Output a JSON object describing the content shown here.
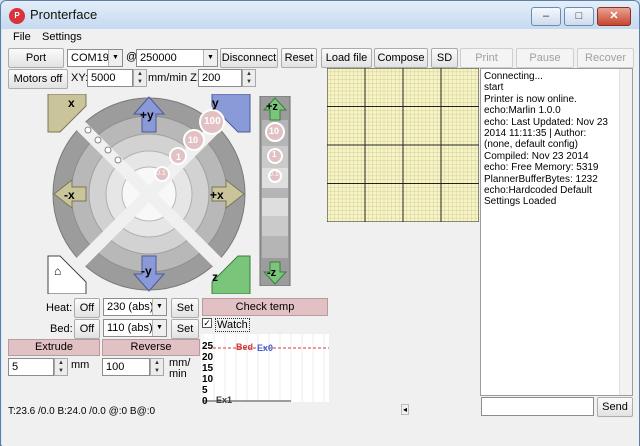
{
  "app": {
    "title": "Pronterface",
    "icon_text": "P"
  },
  "window_controls": {
    "minimize": "–",
    "maximize": "□",
    "close": "✕"
  },
  "menu": [
    "File",
    "Settings"
  ],
  "toolbar": {
    "port_label": "Port",
    "port_value": "COM19",
    "at": "@",
    "baud_value": "250000",
    "disconnect": "Disconnect",
    "reset": "Reset",
    "load_file": "Load file",
    "compose": "Compose",
    "sd": "SD",
    "print": "Print",
    "pause": "Pause",
    "recover": "Recover"
  },
  "motion": {
    "motors_off": "Motors off",
    "xy_label": "XY:",
    "xy_value": "5000",
    "mm_min_z": "mm/min Z:",
    "z_value": "200"
  },
  "jog": {
    "home_x": "x",
    "home_y": "y",
    "home_z": "z",
    "plus_y": "+y",
    "minus_y": "-y",
    "plus_x": "+x",
    "minus_x": "-x",
    "steps": [
      "100",
      "10",
      "1",
      "0.1"
    ],
    "z_plus": "+z",
    "z_minus": "-z",
    "z_steps": [
      "10",
      "1",
      "0.1"
    ]
  },
  "temps": {
    "heat_label": "Heat:",
    "heat_off": "Off",
    "heat_value": "230 (abs)",
    "heat_set": "Set",
    "bed_label": "Bed:",
    "bed_off": "Off",
    "bed_value": "110 (abs)",
    "bed_set": "Set",
    "check_temp": "Check temp",
    "watch": "Watch"
  },
  "extrude": {
    "extrude": "Extrude",
    "reverse": "Reverse",
    "length": "5",
    "length_unit": "mm",
    "speed": "100",
    "speed_unit": "mm/\nmin"
  },
  "graph": {
    "ticks": [
      "25",
      "20",
      "15",
      "10",
      "5",
      "0"
    ],
    "bed_label": "Bed",
    "ex0_label": "Ex0",
    "ex1_label": "Ex1",
    "bed_color": "#d23a3a",
    "ex0_color": "#3a5fd2",
    "ex1_color": "#3a3a3a"
  },
  "log": {
    "lines": [
      "Connecting...",
      "start",
      "Printer is now online.",
      "echo:Marlin 1.0.0",
      "echo: Last Updated: Nov 23",
      "2014 11:11:35 | Author:",
      "(none, default config)",
      "Compiled: Nov 23 2014",
      "echo: Free Memory: 5319",
      "PlannerBufferBytes: 1232",
      "echo:Hardcoded Default",
      "Settings Loaded"
    ]
  },
  "send": {
    "button": "Send",
    "value": ""
  },
  "status": {
    "text": "T:23.6 /0.0 B:24.0 /0.0 @:0 B@:0"
  },
  "colors": {
    "grid_bg": "#f7f5c6",
    "arrow_blue": "#8a9ad8",
    "arrow_olive": "#c9c49a",
    "arrow_green": "#79c57a",
    "pink_button": "#e2c1c4"
  }
}
